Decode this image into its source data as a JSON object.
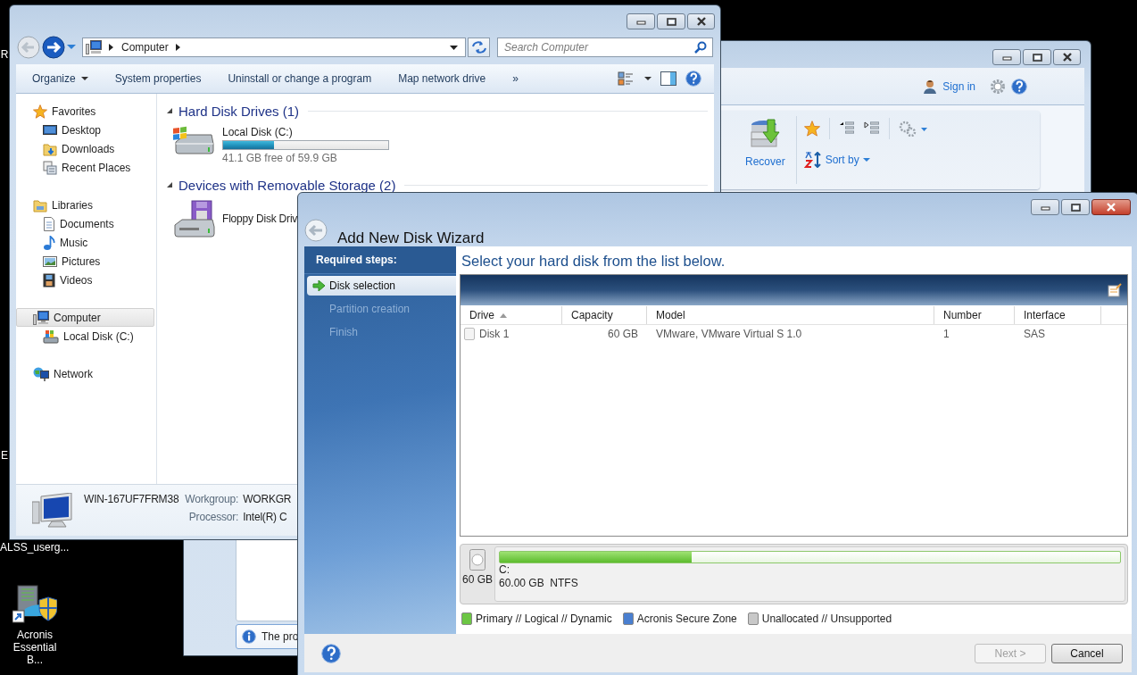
{
  "desktop": {
    "icons": [
      {
        "label": "R",
        "kind": "label"
      },
      {
        "label": "E",
        "kind": "label"
      },
      {
        "label": "ALSS_userg...",
        "kind": "label"
      },
      {
        "label": "Acronis Essential B...",
        "kind": "shortcut"
      }
    ]
  },
  "backup_window": {
    "sign_in": "Sign in",
    "toolbar": [
      {
        "label": "Recover"
      },
      {
        "label": "Sort by"
      }
    ],
    "info_bar": "The pro"
  },
  "explorer": {
    "address": [
      "Computer"
    ],
    "search": {
      "placeholder": "Search Computer"
    },
    "toolbar": [
      {
        "label": "Organize",
        "kind": "menu"
      },
      {
        "label": "System properties",
        "kind": "button"
      },
      {
        "label": "Uninstall or change a program",
        "kind": "button"
      },
      {
        "label": "Map network drive",
        "kind": "button"
      },
      {
        "label": "»",
        "kind": "button"
      }
    ],
    "sidebar": {
      "items": [
        {
          "label": "Favorites",
          "selected": false,
          "children": [
            {
              "label": "Desktop",
              "selected": false
            },
            {
              "label": "Downloads",
              "selected": false
            },
            {
              "label": "Recent Places",
              "selected": false
            }
          ]
        },
        {
          "label": "Libraries",
          "selected": false,
          "children": [
            {
              "label": "Documents",
              "selected": false
            },
            {
              "label": "Music",
              "selected": false
            },
            {
              "label": "Pictures",
              "selected": false
            },
            {
              "label": "Videos",
              "selected": false
            }
          ]
        },
        {
          "label": "Computer",
          "selected": true,
          "children": [
            {
              "label": "Local Disk (C:)",
              "selected": false
            }
          ]
        },
        {
          "label": "Network",
          "selected": false
        }
      ]
    },
    "groups": [
      {
        "title": "Hard Disk Drives (1)",
        "items": [
          {
            "name": "Local Disk (C:)",
            "kind": "drive",
            "level": 0.31,
            "info": "41.1 GB free of 59.9 GB"
          }
        ]
      },
      {
        "title": "Devices with Removable Storage (2)",
        "items": [
          {
            "name": "Floppy Disk Driv",
            "kind": "floppy"
          }
        ]
      }
    ],
    "details": {
      "computer_name": "WIN-167UF7FRM38",
      "fields": [
        {
          "label": "Workgroup:",
          "value": "WORKGR"
        },
        {
          "label": "Processor:",
          "value": "Intel(R) C"
        }
      ]
    }
  },
  "wizard": {
    "title": "Add New Disk Wizard",
    "steps_heading": "Required steps:",
    "steps": [
      {
        "label": "Disk selection",
        "selected": true,
        "disabled": false
      },
      {
        "label": "Partition creation",
        "selected": false,
        "disabled": true
      },
      {
        "label": "Finish",
        "selected": false,
        "disabled": true
      }
    ],
    "heading": "Select your hard disk from the list below.",
    "table": {
      "columns": [
        {
          "label": "Drive",
          "sorted": true
        },
        {
          "label": "Capacity",
          "sorted": false
        },
        {
          "label": "Model",
          "sorted": false
        },
        {
          "label": "Number",
          "sorted": false
        },
        {
          "label": "Interface",
          "sorted": false
        }
      ],
      "rows": [
        {
          "checked": false,
          "selected": false,
          "cells": [
            "Disk 1",
            "60 GB",
            "VMware, VMware Virtual S 1.0",
            "1",
            "SAS"
          ]
        }
      ]
    },
    "disk_map": {
      "size": "60 GB",
      "partition": "C:",
      "info": "60.00 GB  NTFS",
      "level": 0.31
    },
    "legend": [
      {
        "label": "Primary // Logical // Dynamic",
        "color": "#6cc644"
      },
      {
        "label": "Acronis Secure Zone",
        "color": "#4a7fd0"
      },
      {
        "label": "Unallocated // Unsupported",
        "color": "#c8c8c8"
      }
    ],
    "buttons": [
      {
        "label": "Next >",
        "disabled": true
      },
      {
        "label": "Cancel",
        "disabled": false
      }
    ]
  }
}
